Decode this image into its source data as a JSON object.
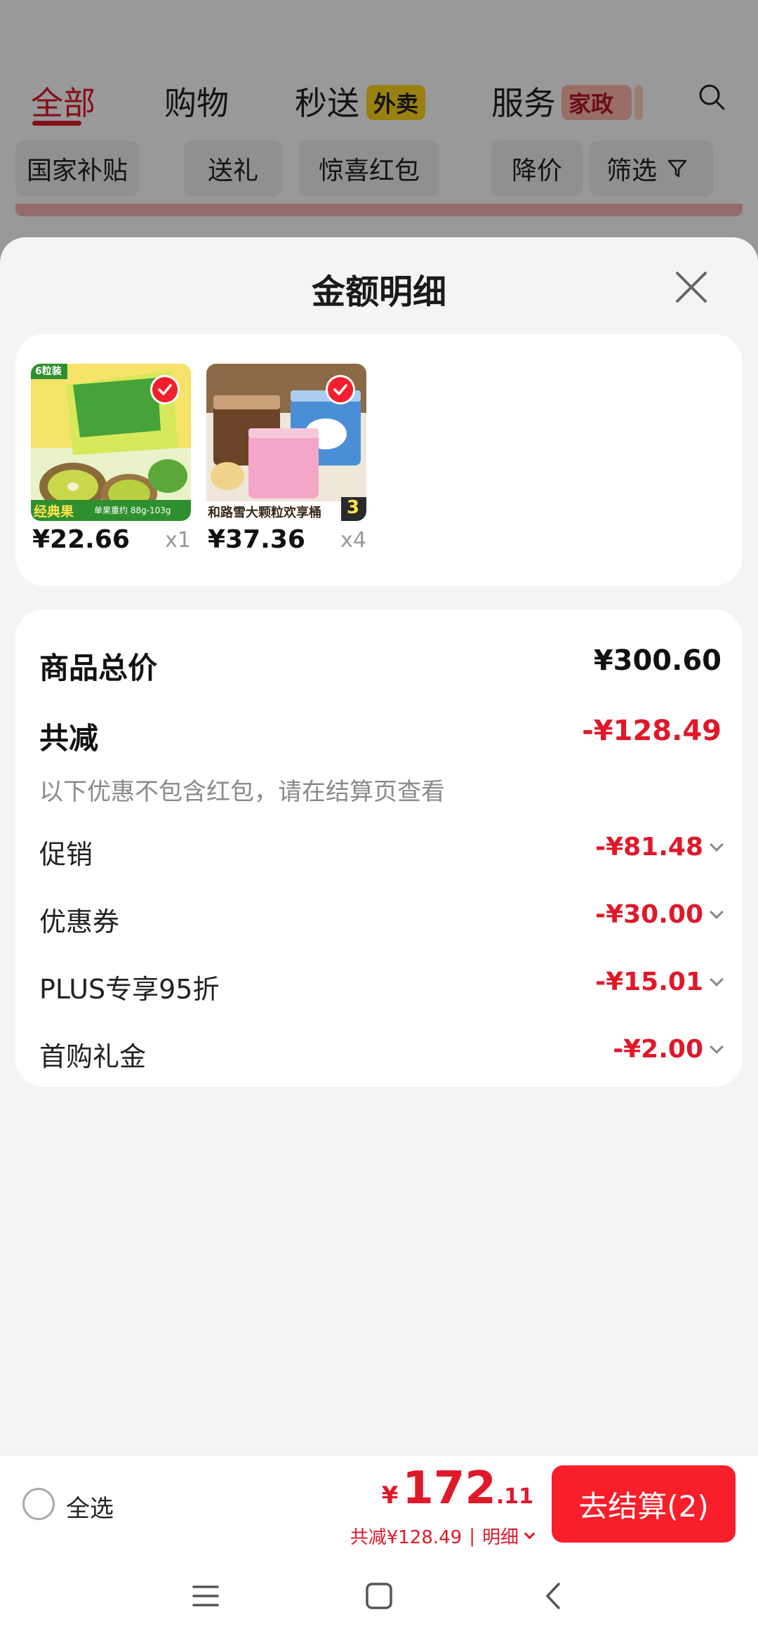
{
  "background": {
    "tabs": [
      {
        "label": "全部"
      },
      {
        "label": "购物"
      },
      {
        "label": "秒送"
      },
      {
        "label": "服务"
      }
    ],
    "tab_badges": {
      "takeout": "外卖",
      "housekeeping": "家政"
    },
    "chips": [
      "国家补贴",
      "送礼",
      "惊喜红包",
      "降价",
      "筛选"
    ]
  },
  "sheet": {
    "title": "金额明细",
    "products": [
      {
        "price": "¥22.66",
        "qty": "x1",
        "pack_tag": "6粒装",
        "banner": "经典果",
        "caption": "单果重约 88g-103g"
      },
      {
        "price": "¥37.36",
        "qty": "x4",
        "banner": "和路雪大颗粒欢享桶",
        "count_tag": "3"
      }
    ],
    "summary": {
      "total_label": "商品总价",
      "total_value": "¥300.60",
      "reduction_label": "共减",
      "reduction_value": "-¥128.49",
      "note": "以下优惠不包含红包，请在结算页查看",
      "items": [
        {
          "label": "促销",
          "value": "-¥81.48"
        },
        {
          "label": "优惠券",
          "value": "-¥30.00"
        },
        {
          "label": "PLUS专享95折",
          "value": "-¥15.01"
        },
        {
          "label": "首购礼金",
          "value": "-¥2.00"
        }
      ]
    }
  },
  "bottom_bar": {
    "select_all": "全选",
    "currency": "¥",
    "pay_int": "172",
    "pay_dec": ".11",
    "savings": "共减¥128.49",
    "detail": "明细",
    "checkout": "去结算(2)"
  },
  "colors": {
    "accent": "#e0182a",
    "checkout_bg": "#f81e2a"
  }
}
